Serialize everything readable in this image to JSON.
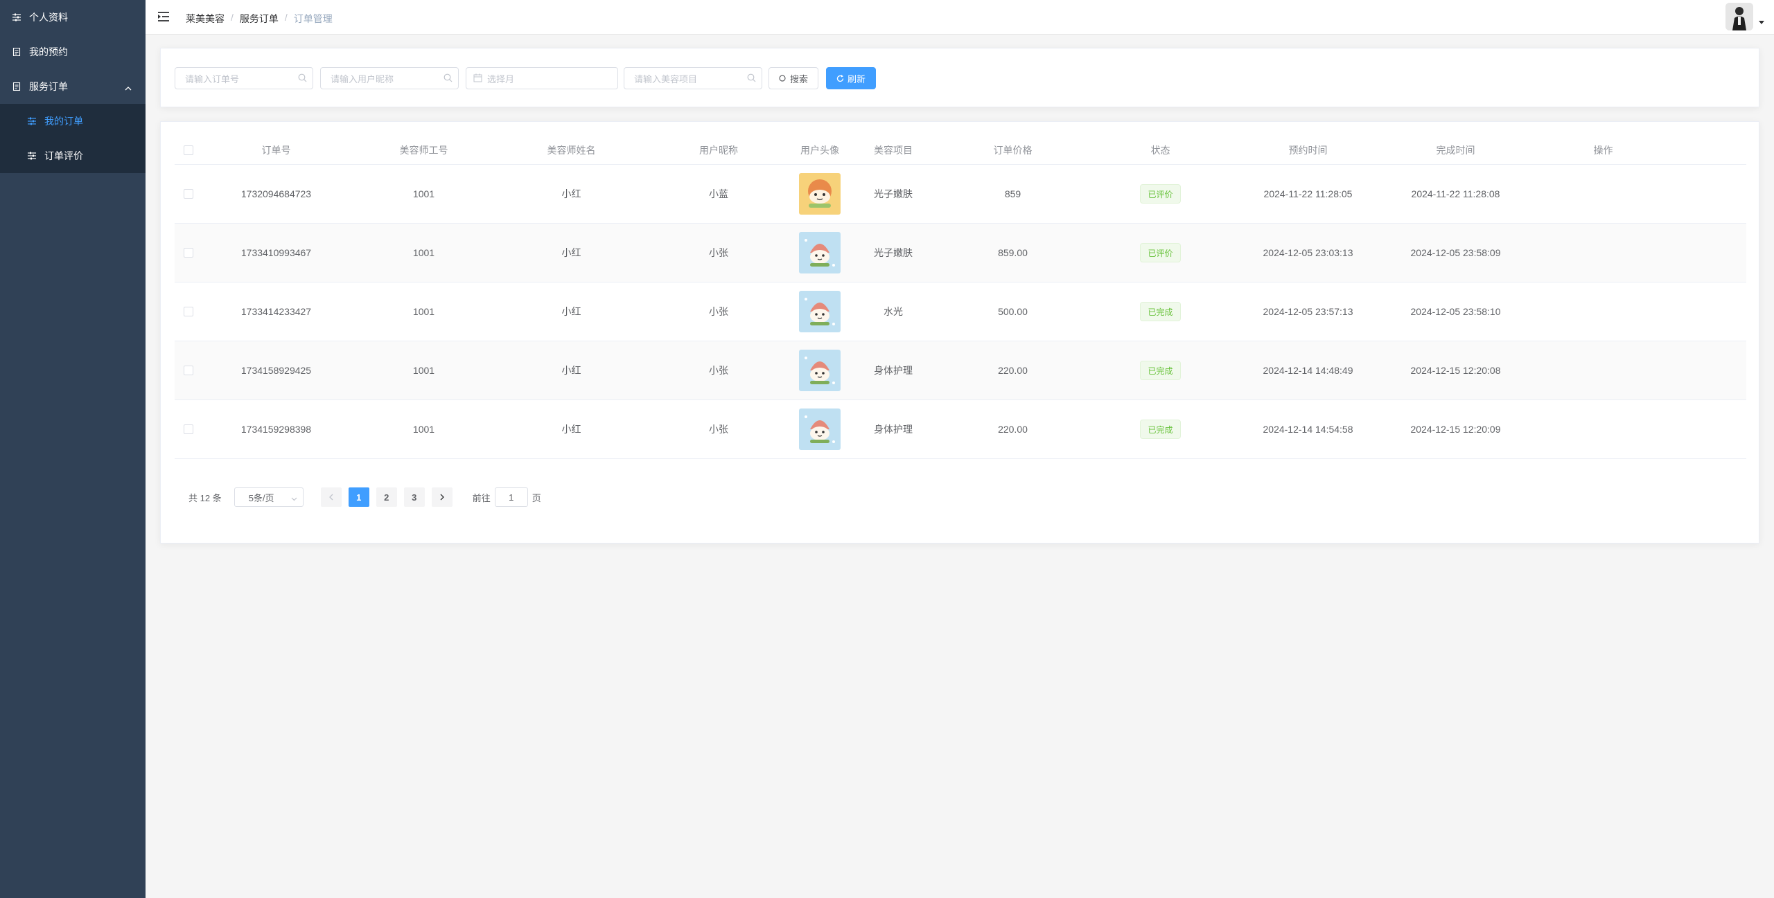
{
  "sidebar": {
    "items": [
      {
        "label": "个人资料",
        "icon": "sliders-icon"
      },
      {
        "label": "我的预约",
        "icon": "document-icon"
      },
      {
        "label": "服务订单",
        "icon": "document-icon",
        "expanded": true
      }
    ],
    "submenu": [
      {
        "label": "我的订单",
        "icon": "sliders-icon",
        "active": true
      },
      {
        "label": "订单评价",
        "icon": "sliders-icon"
      }
    ]
  },
  "header": {
    "breadcrumb": [
      "莱美美容",
      "服务订单",
      "订单管理"
    ]
  },
  "search": {
    "order_no_placeholder": "请输入订单号",
    "nickname_placeholder": "请输入用户昵称",
    "month_placeholder": "选择月",
    "project_placeholder": "请输入美容项目",
    "search_label": "搜索",
    "refresh_label": "刷新"
  },
  "table": {
    "headers": [
      "订单号",
      "美容师工号",
      "美容师姓名",
      "用户昵称",
      "用户头像",
      "美容项目",
      "订单价格",
      "状态",
      "预约时间",
      "完成时间",
      "操作"
    ],
    "rows": [
      {
        "order_no": "1732094684723",
        "staff_no": "1001",
        "staff_name": "小红",
        "nickname": "小蓝",
        "avatar": "orange",
        "project": "光子嫩肤",
        "price": "859",
        "status": "已评价",
        "booked": "2024-11-22 11:28:05",
        "finished": "2024-11-22 11:28:08"
      },
      {
        "order_no": "1733410993467",
        "staff_no": "1001",
        "staff_name": "小红",
        "nickname": "小张",
        "avatar": "blue",
        "project": "光子嫩肤",
        "price": "859.00",
        "status": "已评价",
        "booked": "2024-12-05 23:03:13",
        "finished": "2024-12-05 23:58:09"
      },
      {
        "order_no": "1733414233427",
        "staff_no": "1001",
        "staff_name": "小红",
        "nickname": "小张",
        "avatar": "blue",
        "project": "水光",
        "price": "500.00",
        "status": "已完成",
        "booked": "2024-12-05 23:57:13",
        "finished": "2024-12-05 23:58:10"
      },
      {
        "order_no": "1734158929425",
        "staff_no": "1001",
        "staff_name": "小红",
        "nickname": "小张",
        "avatar": "blue",
        "project": "身体护理",
        "price": "220.00",
        "status": "已完成",
        "booked": "2024-12-14 14:48:49",
        "finished": "2024-12-15 12:20:08"
      },
      {
        "order_no": "1734159298398",
        "staff_no": "1001",
        "staff_name": "小红",
        "nickname": "小张",
        "avatar": "blue",
        "project": "身体护理",
        "price": "220.00",
        "status": "已完成",
        "booked": "2024-12-14 14:54:58",
        "finished": "2024-12-15 12:20:09"
      }
    ]
  },
  "pagination": {
    "total": "共 12 条",
    "page_size": "5条/页",
    "pages": [
      "1",
      "2",
      "3"
    ],
    "current_page": 1,
    "goto_prefix": "前往",
    "goto_value": "1",
    "goto_suffix": "页"
  },
  "colors": {
    "sidebar_bg": "#304156",
    "submenu_bg": "#1f2d3d",
    "primary": "#409eff",
    "success": "#67c23a"
  }
}
